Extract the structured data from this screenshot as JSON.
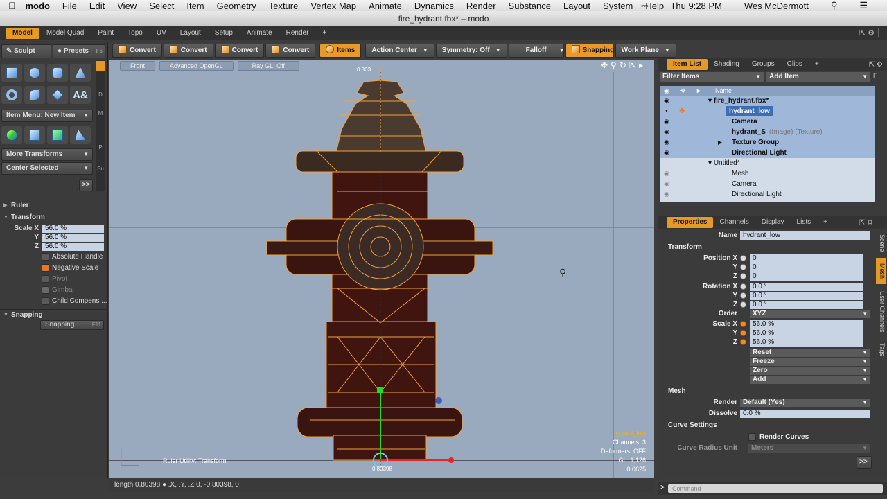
{
  "menubar": {
    "app": "modo",
    "items": [
      "File",
      "Edit",
      "View",
      "Select",
      "Item",
      "Geometry",
      "Texture",
      "Vertex Map",
      "Animate",
      "Dynamics",
      "Render",
      "Substance",
      "Layout",
      "System",
      "Help"
    ],
    "time": "Thu 9:28 PM",
    "user": "Wes McDermott"
  },
  "window": {
    "title": "fire_hydrant.fbx* – modo"
  },
  "layout_tabs": [
    "Model",
    "Model Quad",
    "Paint",
    "Topo",
    "UV",
    "Layout",
    "Setup",
    "Animate",
    "Render"
  ],
  "left": {
    "sculpt": "Sculpt",
    "presets": "Presets",
    "presets_key": "F6",
    "item_menu": "Item Menu: New Item",
    "more_transforms": "More Transforms",
    "center_selected": "Center Selected",
    "more": ">>",
    "strip": [
      "D",
      "M",
      "P",
      "Su"
    ],
    "ruler": "Ruler",
    "transform": "Transform",
    "scale_x_label": "Scale X",
    "y_label": "Y",
    "z_label": "Z",
    "scale_x": "56.0 %",
    "scale_y": "56.0 %",
    "scale_z": "56.0 %",
    "absolute_handle": "Absolute Handle",
    "negative_scale": "Negative Scale",
    "pivot": "Pivot",
    "gimbal": "Gimbal",
    "child_comp": "Child Compens ...",
    "snapping": "Snapping",
    "snapping_btn": "Snapping",
    "snapping_key": "F11"
  },
  "toolbar": {
    "convert1": "Convert",
    "convert2": "Convert",
    "convert3": "Convert",
    "convert4": "Convert",
    "items": "Items",
    "action_center": "Action Center",
    "symmetry": "Symmetry: Off",
    "falloff": "Falloff",
    "snapping": "Snapping",
    "work_plane": "Work Plane"
  },
  "viewport": {
    "view": "Front",
    "shading": "Advanced OpenGL",
    "raygl": "Ray GL: Off",
    "top_readout": "0.803",
    "ruler_readout": "0.80398",
    "ruler_label": "Ruler Utility: Transform",
    "hud": {
      "item": "hydrant_low",
      "channels": "Channels: 3",
      "deformers": "Deformers: OFF",
      "gl": "GL: 1,126",
      "scale": "0.0625"
    },
    "status": "length 0.80398 ● .X, .Y, .Z   0, -0.80398, 0"
  },
  "itemlist": {
    "tabs": [
      "Item List",
      "Shading",
      "Groups",
      "Clips"
    ],
    "filter": "Filter Items",
    "add_item": "Add Item",
    "col_name": "Name",
    "rows": [
      {
        "name": "fire_hydrant.fbx*",
        "extra": ""
      },
      {
        "name": "hydrant_low",
        "extra": ""
      },
      {
        "name": "Camera",
        "extra": ""
      },
      {
        "name": "hydrant_S",
        "extra": "(Image) (Texture)"
      },
      {
        "name": "Texture Group",
        "extra": ""
      },
      {
        "name": "Directional Light",
        "extra": ""
      },
      {
        "name": "Untitled*",
        "extra": ""
      },
      {
        "name": "Mesh",
        "extra": ""
      },
      {
        "name": "Camera",
        "extra": ""
      },
      {
        "name": "Directional Light",
        "extra": ""
      }
    ]
  },
  "properties": {
    "tabs": [
      "Properties",
      "Channels",
      "Display",
      "Lists"
    ],
    "name_label": "Name",
    "name": "hydrant_low",
    "transform": "Transform",
    "position_x_label": "Position X",
    "rotation_x_label": "Rotation X",
    "scale_x_label": "Scale X",
    "order_label": "Order",
    "y": "Y",
    "z": "Z",
    "pos_x": "0",
    "pos_y": "0",
    "pos_z": "0",
    "rot_x": "0.0 °",
    "rot_y": "0.0 °",
    "rot_z": "0.0 °",
    "order": "XYZ",
    "scl_x": "56.0 %",
    "scl_y": "56.0 %",
    "scl_z": "56.0 %",
    "reset": "Reset",
    "freeze": "Freeze",
    "zero": "Zero",
    "add": "Add",
    "mesh": "Mesh",
    "render_label": "Render",
    "render": "Default (Yes)",
    "dissolve_label": "Dissolve",
    "dissolve": "0.0 %",
    "curve_settings": "Curve Settings",
    "render_curves": "Render Curves",
    "curve_radius_label": "Curve Radius Unit",
    "curve_radius": "Meters",
    "more": ">>",
    "side_tabs": [
      "Scene",
      "Mesh",
      "User Channels",
      "Tags"
    ]
  },
  "command": {
    "placeholder": "Command"
  }
}
